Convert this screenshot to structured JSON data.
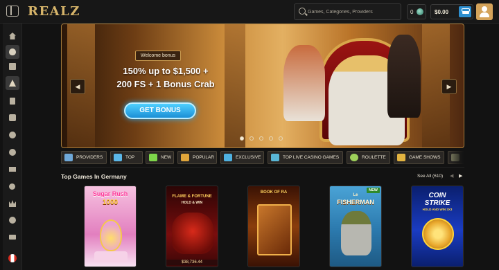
{
  "header": {
    "logo": "REALZ",
    "search_placeholder": "Games, Categories, Providers",
    "bonus_balance": "0",
    "balance": "$0.00",
    "icons": [
      "menu-toggle-icon",
      "search-icon",
      "coin-icon",
      "wallet-icon",
      "user-icon"
    ]
  },
  "sidebar": {
    "items": [
      "home",
      "egg",
      "gift",
      "pyramid",
      "fuel",
      "slot",
      "clover",
      "ball",
      "ticket",
      "medal",
      "crown",
      "coin",
      "casino",
      "canada-flag"
    ]
  },
  "hero": {
    "badge": "Welcome bonus",
    "line1": "150% up to $1,500 +",
    "line2": "200 FS + 1 Bonus Crab",
    "cta": "GET BONUS",
    "slides": 5,
    "active_slide": 1
  },
  "tabs": [
    {
      "label": "PROVIDERS",
      "color": "#6fa8d8"
    },
    {
      "label": "TOP",
      "color": "#5bb7e8"
    },
    {
      "label": "NEW",
      "color": "#7ed64a"
    },
    {
      "label": "POPULAR",
      "color": "#e0a53a"
    },
    {
      "label": "EXCLUSIVE",
      "color": "#4fb1e0"
    },
    {
      "label": "TOP LIVE CASINO GAMES",
      "color": "#59b6d6"
    },
    {
      "label": "ROULETTE",
      "color": "#9ed05a"
    },
    {
      "label": "GAME SHOWS",
      "color": "#e3b440"
    }
  ],
  "section": {
    "title": "Top Games In Germany",
    "see_all": "See All (610)",
    "prev": "◀",
    "next": "▶"
  },
  "games": [
    {
      "title_line1": "Sugar Rush",
      "title_line2": "1000",
      "bg": "#f2a6cf",
      "new": false
    },
    {
      "title_line1": "FLAME & FORTUNE",
      "title_line2": "HOLD & WIN",
      "bg": "#5a0c0c",
      "new": false,
      "jackpot": "$38,736.44"
    },
    {
      "title_line1": "BOOK OF RA",
      "title_line2": "",
      "bg": "#5a2409",
      "new": false
    },
    {
      "title_line1": "Le",
      "title_line2": "FISHERMAN",
      "bg": "#2e7fae",
      "new": true,
      "new_label": "NEW"
    },
    {
      "title_line1": "COIN",
      "title_line2": "STRIKE",
      "title_line3": "HOLD AND WIN 3X3",
      "bg": "#0b2b8c",
      "new": false
    }
  ]
}
